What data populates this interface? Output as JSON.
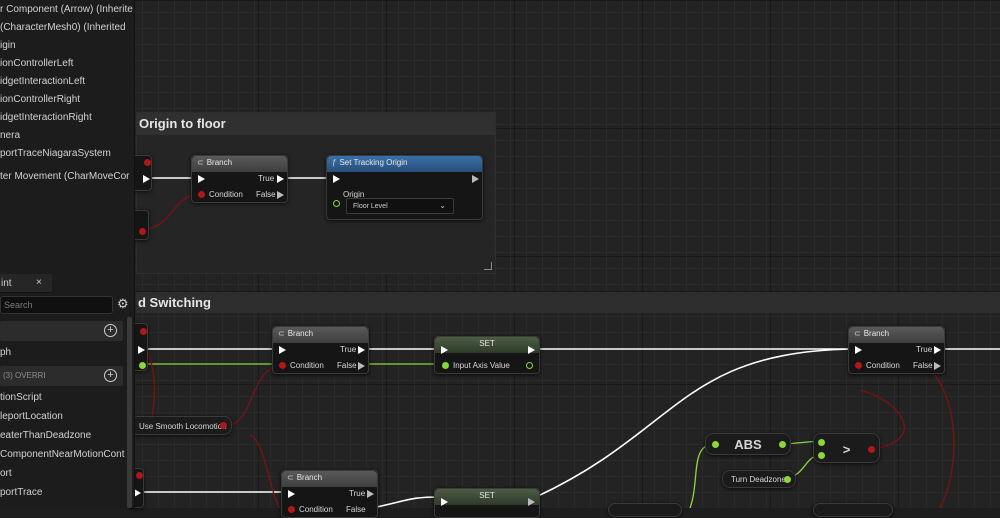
{
  "components": [
    "r Component (Arrow) (Inherite",
    "(CharacterMesh0) (Inherited",
    "igin",
    "ionControllerLeft",
    "idgetInteractionLeft",
    "ionControllerRight",
    "idgetInteractionRight",
    "nera",
    "portTraceNiagaraSystem",
    "ter Movement (CharMoveCor"
  ],
  "my_blueprint": {
    "tab_label": "int",
    "close_glyph": "×",
    "search_placeholder": "Search",
    "category_add": "+",
    "graph_label": "ph",
    "functions_label": "(3) OVERRI",
    "items": [
      "tionScript",
      "leportLocation",
      "eaterThanDeadzone",
      "ComponentNearMotionCont",
      "ort",
      "portTrace"
    ]
  },
  "comments": {
    "tracking": "Origin to floor",
    "switching": "d Switching"
  },
  "nodes": {
    "branch_top": {
      "title": "Branch",
      "true_label": "True",
      "false_label": "False",
      "condition_label": "Condition"
    },
    "set_tracking": {
      "title": "Set Tracking Origin",
      "origin_label": "Origin",
      "origin_value": "Floor Level"
    },
    "branch_a": {
      "title": "Branch",
      "true_label": "True",
      "false_label": "False",
      "condition_label": "Condition"
    },
    "set_a": {
      "title": "SET",
      "input_label": "Input Axis Value"
    },
    "branch_b": {
      "title": "Branch",
      "true_label": "True",
      "false_label": "False",
      "condition_label": "Condition"
    },
    "branch_c": {
      "title": "Branch",
      "true_label": "True",
      "false_label": "False",
      "condition_label": "Condition"
    },
    "set_b": {
      "title": "SET"
    },
    "abs": {
      "title": "ABS"
    },
    "greater": {
      "title": ">"
    },
    "turn_deadzone": {
      "label": "Turn Deadzone"
    },
    "smooth_locomotion": {
      "label": "Use Smooth Locomotion"
    }
  },
  "colors": {
    "exec_wire": "#ffffff",
    "bool_wire": "#b0171a",
    "float_wire": "#8bd63b",
    "function_header": "#3a6fa8"
  }
}
